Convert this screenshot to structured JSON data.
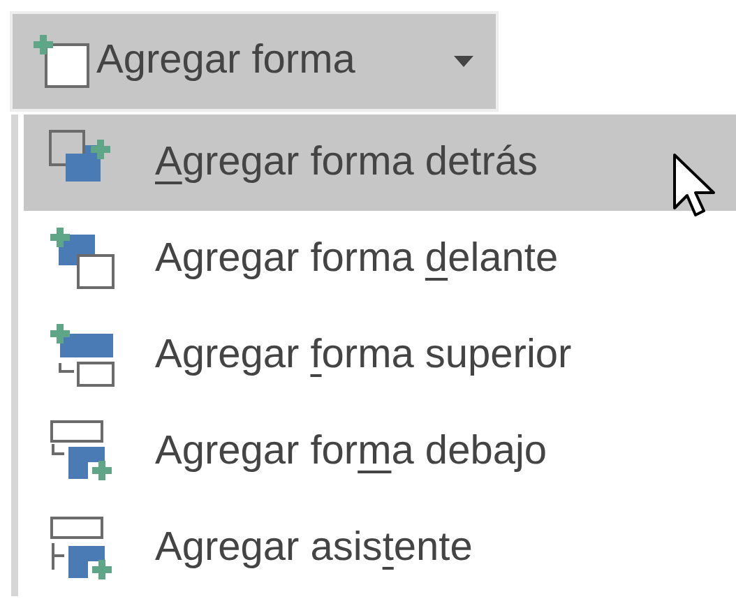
{
  "button": {
    "label": "Agregar forma",
    "expanded": true
  },
  "menu_items": [
    {
      "kind": "behind",
      "key": "A",
      "after": "gregar forma detrás",
      "selected": true
    },
    {
      "kind": "front",
      "before": "Agregar forma ",
      "key": "d",
      "after": "elante",
      "selected": false
    },
    {
      "kind": "above",
      "before": "Agregar ",
      "key": "f",
      "after": "orma superior",
      "selected": false
    },
    {
      "kind": "below",
      "before": "Agregar for",
      "key": "m",
      "after": "a debajo",
      "selected": false
    },
    {
      "kind": "assistant",
      "before": "Agregar asis",
      "key": "t",
      "after": "ente",
      "selected": false
    }
  ]
}
